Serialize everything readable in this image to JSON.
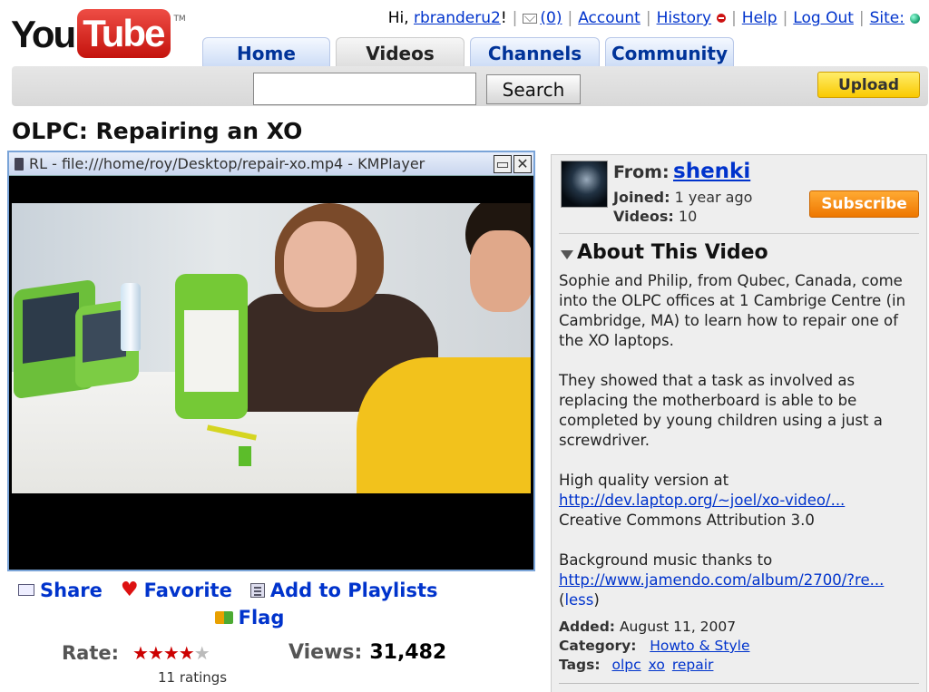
{
  "logo": {
    "you": "You",
    "tube": "Tube",
    "tm": "TM"
  },
  "userbar": {
    "greeting_prefix": "Hi,",
    "username": "rbranderu2",
    "greeting_suffix": "!",
    "mail_count": "(0)",
    "account": "Account",
    "history": "History",
    "help": "Help",
    "logout": "Log Out",
    "site": "Site:"
  },
  "tabs": [
    {
      "label": "Home"
    },
    {
      "label": "Videos"
    },
    {
      "label": "Channels"
    },
    {
      "label": "Community"
    }
  ],
  "search": {
    "value": "",
    "button": "Search"
  },
  "upload_label": "Upload",
  "video": {
    "title": "OLPC: Repairing an XO",
    "player_window_title": "RL - file:///home/roy/Desktop/repair-xo.mp4 - KMPlayer"
  },
  "actions": {
    "share": "Share",
    "favorite": "Favorite",
    "add_to_playlists": "Add to Playlists",
    "flag": "Flag"
  },
  "rating": {
    "label": "Rate:",
    "stars_filled": 4,
    "stars_total": 5,
    "count_text": "11 ratings",
    "star_on": "★★★★",
    "star_off": "★"
  },
  "views": {
    "label": "Views:",
    "count": "31,482"
  },
  "uploader": {
    "from_label": "From:",
    "name": "shenki",
    "joined_label": "Joined:",
    "joined_value": "1 year ago",
    "videos_label": "Videos:",
    "videos_value": "10",
    "subscribe": "Subscribe"
  },
  "about": {
    "heading": "About This Video",
    "para1": "Sophie and Philip, from Qubec, Canada, come into the OLPC offices at 1 Cambrige Centre (in Cambridge, MA) to learn how to repair one of the XO laptops.",
    "para2": "They showed that a task as involved as replacing the motherboard is able to be completed by young children using a just a screwdriver.",
    "hq_text": "High quality version at",
    "hq_link": "http://dev.laptop.org/~joel/xo-video/...",
    "license": "Creative Commons Attribution 3.0",
    "music_text": "Background music thanks to",
    "music_link": "http://www.jamendo.com/album/2700/?re...",
    "less_open": "(",
    "less": "less",
    "less_close": ")"
  },
  "meta": {
    "added_label": "Added:",
    "added_value": "August 11, 2007",
    "category_label": "Category:",
    "category_value": "Howto & Style",
    "tags_label": "Tags:",
    "tags": [
      "olpc",
      "xo",
      "repair"
    ]
  },
  "colors": {
    "link": "#0033cc",
    "upload_yellow": "#f9c900",
    "subscribe_orange": "#ee7700",
    "star_red": "#cc0000"
  }
}
